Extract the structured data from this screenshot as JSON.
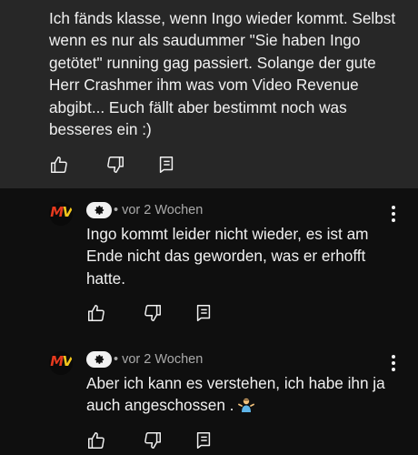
{
  "top_comment": {
    "text": "Ich fänds klasse, wenn Ingo wieder kommt. Selbst wenn es nur als saudummer \"Sie haben Ingo getötet\" running gag passiert. Solange der gute Herr Crashmer ihm was vom Video Revenue abgibt... Euch fällt aber bestimmt noch was besseres ein :)"
  },
  "replies": [
    {
      "avatar_text": "MV",
      "time": "• vor 2 Wochen",
      "text": "Ingo kommt leider nicht wieder, es ist am Ende nicht das geworden, was er erhofft hatte."
    },
    {
      "avatar_text": "MV",
      "time": "• vor 2 Wochen",
      "text": "Aber ich kann es verstehen, ich habe ihn ja auch angeschossen . "
    }
  ],
  "icons": {
    "like": "thumbs-up-icon",
    "dislike": "thumbs-down-icon",
    "reply": "reply-comment-icon",
    "menu": "more-vert-icon",
    "creator": "creator-badge-icon",
    "emoji": "person-shrugging-emoji"
  },
  "colors": {
    "background": "#0f0f0f",
    "highlight": "#272727",
    "text": "#f1f1f1",
    "meta": "#aaaaaa",
    "avatar_red": "#e63a1e",
    "avatar_yellow": "#f4c81c"
  }
}
